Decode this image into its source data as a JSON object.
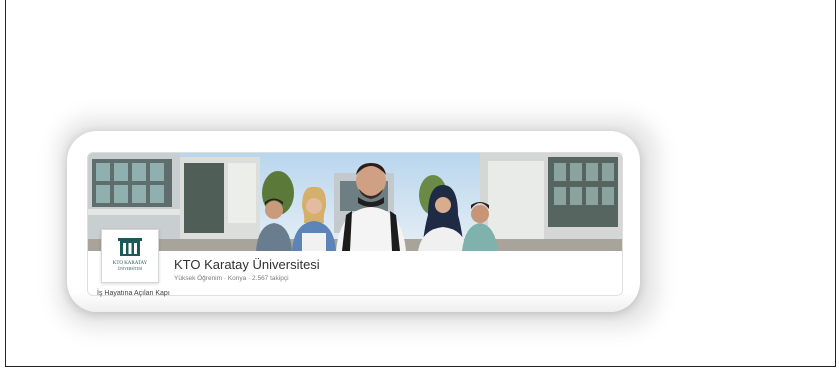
{
  "company": {
    "name": "KTO Karatay Üniversitesi",
    "meta": "Yüksek Öğrenim · Konya · 2.567 takipçi",
    "tagline": "İş Hayatına Açılan Kapı",
    "logo_text_line1": "KTO KARATAY",
    "logo_text_line2": "ÜNİVERSİTESİ"
  },
  "colors": {
    "logo_teal": "#1d5a57",
    "sky": "#cfe4f3"
  }
}
